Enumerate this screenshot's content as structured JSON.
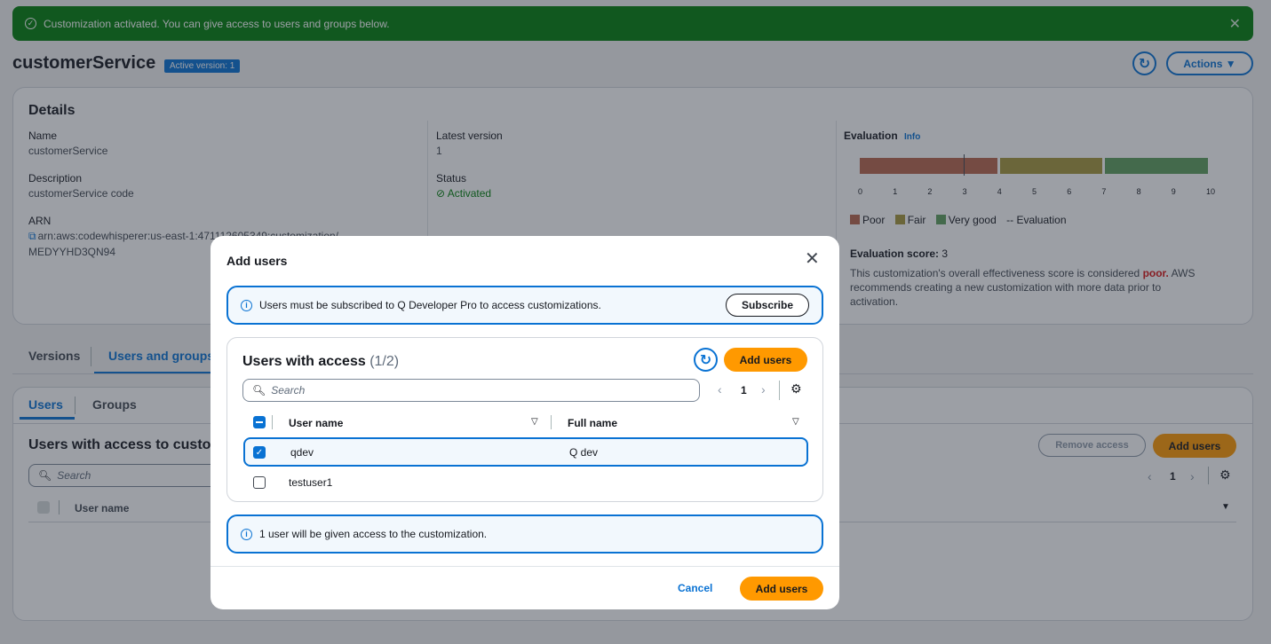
{
  "flash": {
    "message": "Customization activated. You can give access to users and groups below.",
    "close": "✕"
  },
  "page": {
    "title": "customerService",
    "badge": "Active version: 1",
    "refresh_icon": "refresh-icon",
    "actions_label": "Actions ▼"
  },
  "details": {
    "heading": "Details",
    "name_label": "Name",
    "name_value": "customerService",
    "desc_label": "Description",
    "desc_value": "customerService code",
    "arn_label": "ARN",
    "arn_line1": "arn:aws:codewhisperer:us-east-1:471112605349:customization/",
    "arn_line2": "MEDYYHD3QN94",
    "latest_label": "Latest version",
    "latest_value": "1",
    "status_label": "Status",
    "status_value": "Activated"
  },
  "evaluation": {
    "label": "Evaluation",
    "info": "Info",
    "scale": [
      "0",
      "1",
      "2",
      "3",
      "4",
      "5",
      "6",
      "7",
      "8",
      "9",
      "10"
    ],
    "score_value": 3,
    "colors": {
      "poor": "#b9664e",
      "fair": "#a6983d",
      "very_good": "#5f9e5e"
    },
    "legend": {
      "poor": "Poor",
      "fair": "Fair",
      "very_good": "Very good",
      "evaluation": "Evaluation"
    },
    "score_label": "Evaluation score:",
    "score": "3",
    "desc_before": "This customization's overall effectiveness score is considered ",
    "desc_bold": "poor.",
    "desc_line1_end": " AWS",
    "desc_line2": "recommends creating a new customization with more data prior to",
    "desc_line3": "activation."
  },
  "main_tabs": {
    "versions": "Versions",
    "users_groups": "Users and groups"
  },
  "sub_tabs": {
    "users": "Users",
    "groups": "Groups"
  },
  "bg_table": {
    "title": "Users with access to custo",
    "search_placeholder": "Search",
    "remove_access": "Remove access",
    "add_users": "Add users",
    "page": "1",
    "col_user": "User name"
  },
  "modal": {
    "title": "Add users",
    "info_top": "Users must be subscribed to Q Developer Pro to access customizations.",
    "subscribe": "Subscribe",
    "inner_title": "Users with access",
    "inner_count": "(1/2)",
    "add_users_inner": "Add users",
    "search_placeholder": "Search",
    "page": "1",
    "col_user": "User name",
    "col_full": "Full name",
    "rows": [
      {
        "user": "qdev",
        "full": "Q dev",
        "checked": true
      },
      {
        "user": "testuser1",
        "full": "",
        "checked": false
      }
    ],
    "info_bottom": "1 user will be given access to the customization.",
    "cancel": "Cancel",
    "add_users": "Add users"
  }
}
